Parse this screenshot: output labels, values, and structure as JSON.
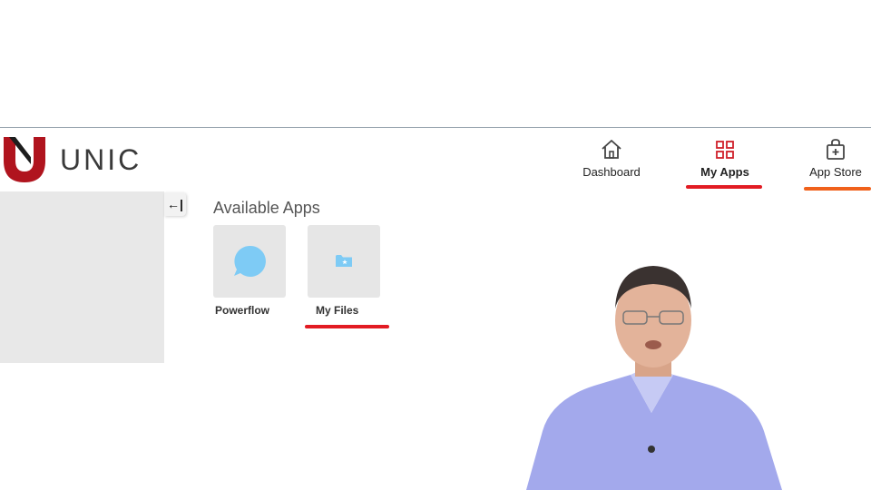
{
  "header": {
    "brand_name": "UNIC",
    "logo_icon": "unic-logo-icon",
    "colors": {
      "brand_red": "#b0141e",
      "active_underline": "#e21b23",
      "hover_underline": "#f0611b"
    }
  },
  "nav": {
    "items": [
      {
        "label": "Dashboard",
        "icon": "home-icon",
        "active": false
      },
      {
        "label": "My Apps",
        "icon": "grid-icon",
        "active": true
      },
      {
        "label": "App Store",
        "icon": "shopping-bag-plus-icon",
        "active": false
      }
    ]
  },
  "sidebar": {
    "collapse_label": "←|",
    "collapse_icon": "collapse-left-icon"
  },
  "main": {
    "section_title": "Available Apps",
    "apps": [
      {
        "label": "Powerflow",
        "icon": "chat-bubble-icon"
      },
      {
        "label": "My Files",
        "icon": "folder-star-icon"
      }
    ]
  }
}
